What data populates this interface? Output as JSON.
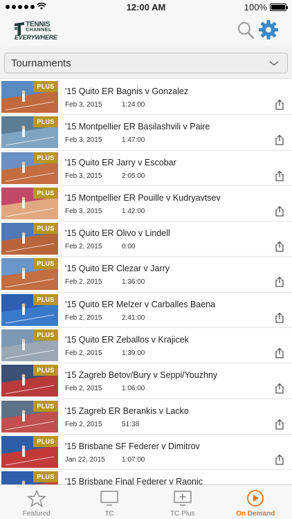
{
  "status_bar": {
    "time": "12:00 AM",
    "battery": "100%",
    "battery_level": 1.0
  },
  "header": {
    "logo_line1": "TENNIS",
    "logo_line2": "CHANNEL",
    "logo_line3": "EVERYWHERE",
    "search_icon": "search-icon",
    "settings_icon": "gear-icon",
    "accent_color": "#3d87c9"
  },
  "filter": {
    "selected": "Tournaments"
  },
  "badge_label": "PLUS",
  "colors": {
    "badge": "#b8961e",
    "active_tab": "#e8731b"
  },
  "videos": [
    {
      "title": "'15 Quito ER Bagnis v Gonzalez",
      "date": "Feb 3, 2015",
      "duration": "1:24:00",
      "thumb_colors": [
        "#5a8ac0",
        "#c06a3e"
      ]
    },
    {
      "title": "'15 Montpellier ER Basilashvili v Paire",
      "date": "Feb 3, 2015",
      "duration": "1:47:00",
      "thumb_colors": [
        "#5b7d95",
        "#7fa5c2"
      ]
    },
    {
      "title": "'15 Quito ER Jarry v Escobar",
      "date": "Feb 3, 2015",
      "duration": "2:05:00",
      "thumb_colors": [
        "#6a8fc0",
        "#c46d40"
      ]
    },
    {
      "title": "'15 Montpellier ER Pouille v Kudryavtsev",
      "date": "Feb 3, 2015",
      "duration": "1:42:00",
      "thumb_colors": [
        "#c04a68",
        "#e0a880"
      ]
    },
    {
      "title": "'15 Quito ER Olivo v Lindell",
      "date": "Feb 2, 2015",
      "duration": "0:00",
      "thumb_colors": [
        "#4f78b5",
        "#b9653c"
      ]
    },
    {
      "title": "'15 Quito ER Clezar v Jarry",
      "date": "Feb 2, 2015",
      "duration": "1:36:00",
      "thumb_colors": [
        "#6a96c8",
        "#c26d42"
      ]
    },
    {
      "title": "'15 Quito ER Melzer v Carballes Baena",
      "date": "Feb 2, 2015",
      "duration": "2:41:00",
      "thumb_colors": [
        "#2e5fb0",
        "#3a7acb"
      ]
    },
    {
      "title": "'15 Quito ER Zeballos v Krajicek",
      "date": "Feb 2, 2015",
      "duration": "1:39:00",
      "thumb_colors": [
        "#7d98b5",
        "#9aa8b6"
      ]
    },
    {
      "title": "'15 Zagreb Betov/Bury v Seppi/Youzhny",
      "date": "Feb 2, 2015",
      "duration": "1:06:00",
      "thumb_colors": [
        "#3c4f75",
        "#b83a3a"
      ]
    },
    {
      "title": "'15 Zagreb ER Berankis v Lacko",
      "date": "Feb 2, 2015",
      "duration": "51:38",
      "thumb_colors": [
        "#5e7288",
        "#c25050"
      ]
    },
    {
      "title": "'15 Brisbane SF Federer v Dimitrov",
      "date": "Jan 22, 2015",
      "duration": "1:07:00",
      "thumb_colors": [
        "#2f5ea8",
        "#c23a3a"
      ]
    },
    {
      "title": "'15 Brisbane Final Federer v Raonic",
      "date": "",
      "duration": "",
      "thumb_colors": [
        "#2f5ea8",
        "#c2403a"
      ]
    }
  ],
  "tabs": [
    {
      "label": "Featured",
      "icon": "star-icon",
      "active": false
    },
    {
      "label": "TC",
      "icon": "tv-icon",
      "active": false
    },
    {
      "label": "TC Plus",
      "icon": "tv-plus-icon",
      "active": false
    },
    {
      "label": "On Demand",
      "icon": "play-circle-icon",
      "active": true
    }
  ]
}
